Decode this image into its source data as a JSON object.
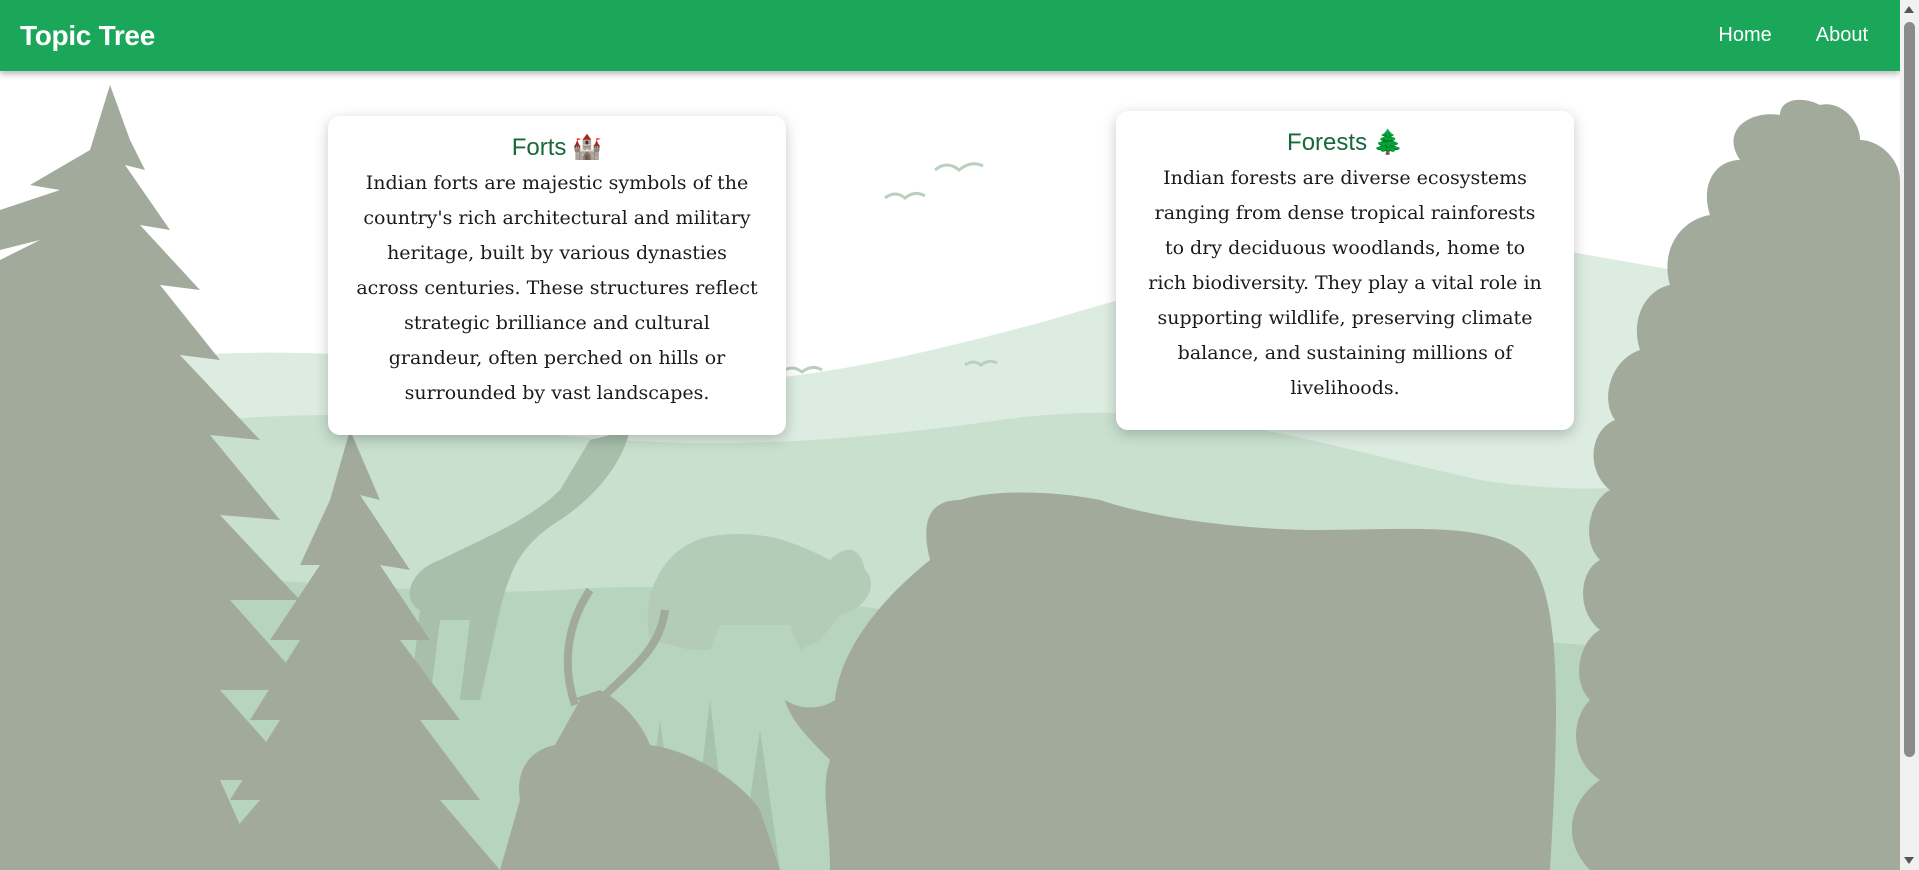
{
  "navbar": {
    "brand": "Topic Tree",
    "links": [
      "Home",
      "About"
    ]
  },
  "cards": [
    {
      "title": "Forts",
      "icon": "castle-icon",
      "icon_glyph": "🏰",
      "text": "Indian forts are majestic symbols of the country's rich architectural and military heritage, built by various dynasties across centuries. These structures reflect strategic brilliance and cultural grandeur, often perched on hills or surrounded by vast landscapes."
    },
    {
      "title": "Forests",
      "icon": "evergreen-tree-icon",
      "icon_glyph": "🌲",
      "text": "Indian forests are diverse ecosystems ranging from dense tropical rainforests to dry deciduous woodlands, home to rich biodiversity. They play a vital role in supporting wildlife, preserving climate balance, and sustaining millions of livelihoods."
    }
  ],
  "colors": {
    "navbar": "#1aa75a",
    "card_title": "#17683a",
    "silhouette": "#a2aa9c",
    "hills_light": "#dcece0",
    "hills_mid": "#c5dfcc"
  }
}
